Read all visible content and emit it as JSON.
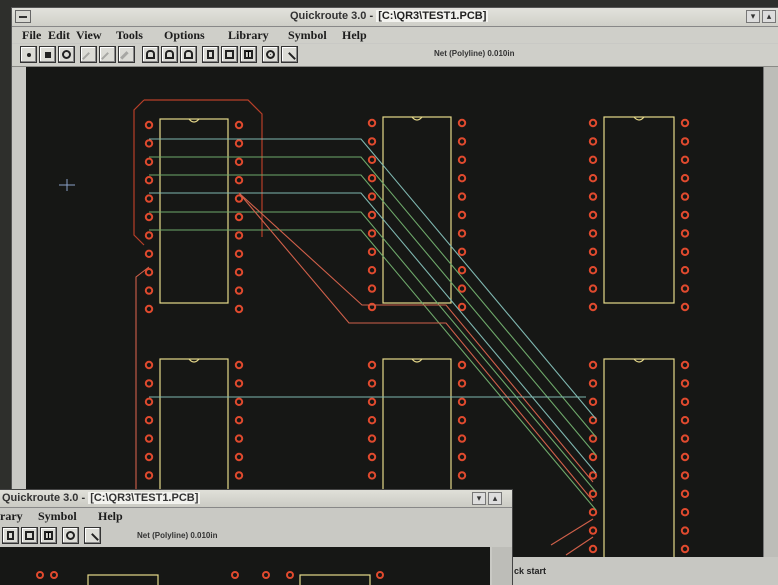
{
  "window": {
    "title_prefix": "Quickroute 3.0 - ",
    "title_path": "[C:\\QR3\\TEST1.PCB]"
  },
  "menu": [
    "File",
    "Edit",
    "View",
    "Tools",
    "Options",
    "Library",
    "Symbol",
    "Help"
  ],
  "toolbar": {
    "buttons": [
      "pointer-tool",
      "pad-tool",
      "round-pad-tool",
      "line-tool",
      "polyline-tool",
      "track-tool",
      "component-tool",
      "smd-tool",
      "dil-tool",
      "symbol-tool",
      "rectangle-tool",
      "text-tool",
      "target-tool",
      "route-tool"
    ],
    "status": "Net (Polyline) 0.010in"
  },
  "colors": {
    "board": "#161715",
    "pad": "#e04a2e",
    "outline_yellow": "#e6d98a",
    "trace_green": "#6ea86a",
    "trace_cyan": "#7fb7b0",
    "trace_red": "#d0604a"
  },
  "taskbar": {
    "start": "ck start"
  },
  "second_window": {
    "title_prefix": "Quickroute 3.0 - ",
    "title_path": "[C:\\QR3\\TEST1.PCB]",
    "menu": [
      "rary",
      "Symbol",
      "Help"
    ],
    "status": "Net (Polyline) 0.010in"
  }
}
